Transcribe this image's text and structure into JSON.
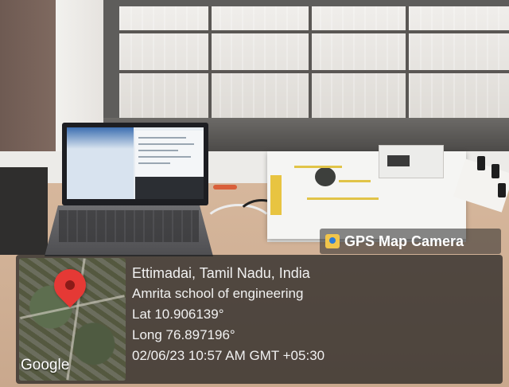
{
  "overlay": {
    "badge_label": "GPS Map Camera",
    "location": "Ettimadai, Tamil Nadu, India",
    "place": "Amrita school of engineering",
    "latitude": "Lat 10.906139°",
    "longitude": "Long 76.897196°",
    "timestamp": "02/06/23 10:57 AM GMT +05:30",
    "map_brand": "Google"
  },
  "icons": {
    "badge_icon": "gps-camera-icon",
    "pin_icon": "map-pin-icon"
  },
  "colors": {
    "pin": "#e53935",
    "device_accent": "#e1c448"
  }
}
